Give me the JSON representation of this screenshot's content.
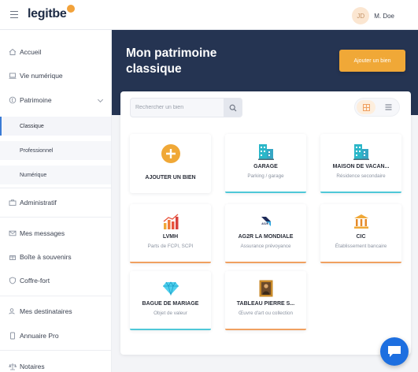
{
  "header": {
    "logo_text": "legitbe",
    "user": {
      "initials": "JD",
      "name": "M. Doe"
    }
  },
  "sidebar": {
    "items": [
      {
        "label": "Accueil",
        "icon": "home-icon"
      },
      {
        "label": "Vie numérique",
        "icon": "laptop-icon"
      },
      {
        "label": "Patrimoine",
        "icon": "coin-icon",
        "expanded": true
      },
      {
        "label": "Classique",
        "sub": true,
        "active": true
      },
      {
        "label": "Professionnel",
        "sub": true
      },
      {
        "label": "Numérique",
        "sub": true
      },
      {
        "label": "Administratif",
        "icon": "briefcase-icon"
      },
      {
        "label": "Mes messages",
        "icon": "mail-icon"
      },
      {
        "label": "Boîte à souvenirs",
        "icon": "gift-icon"
      },
      {
        "label": "Coffre-fort",
        "icon": "shield-icon"
      },
      {
        "label": "Mes destinataires",
        "icon": "users-icon"
      },
      {
        "label": "Annuaire Pro",
        "icon": "phone-icon"
      },
      {
        "label": "Notaires",
        "icon": "balance-icon"
      }
    ]
  },
  "main": {
    "title": "Mon patrimoine classique",
    "add_button": "Ajouter un bien",
    "search_placeholder": "Rechercher un bien",
    "view_mode": "grid",
    "cards": [
      {
        "title": "AJOUTER UN BIEN",
        "subtitle": "",
        "icon": "plus-circle-icon",
        "bar": ""
      },
      {
        "title": "GARAGE",
        "subtitle": "Parking / garage",
        "icon": "building-icon",
        "bar": "cyan"
      },
      {
        "title": "MAISON DE VACAN...",
        "subtitle": "Résidence secondaire",
        "icon": "building-icon",
        "bar": "cyan"
      },
      {
        "title": "LVMH",
        "subtitle": "Parts de FCPI, SCPI",
        "icon": "bar-chart-icon",
        "bar": "orange"
      },
      {
        "title": "AG2R LA MONDIALE",
        "subtitle": "Assurance prévoyance",
        "icon": "ag2r-logo-icon",
        "bar": "orange"
      },
      {
        "title": "CIC",
        "subtitle": "Établissement bancaire",
        "icon": "bank-icon",
        "bar": "orange"
      },
      {
        "title": "BAGUE DE MARIAGE",
        "subtitle": "Objet de valeur",
        "icon": "diamond-icon",
        "bar": "cyan"
      },
      {
        "title": "TABLEAU PIERRE S...",
        "subtitle": "Œuvre d'art ou collection",
        "icon": "painting-icon",
        "bar": "orange"
      }
    ]
  },
  "colors": {
    "banner": "#253452",
    "accent": "#f0a837",
    "cyan": "#4fc8d8",
    "orange": "#f0a060",
    "chat": "#1d6fe0"
  }
}
